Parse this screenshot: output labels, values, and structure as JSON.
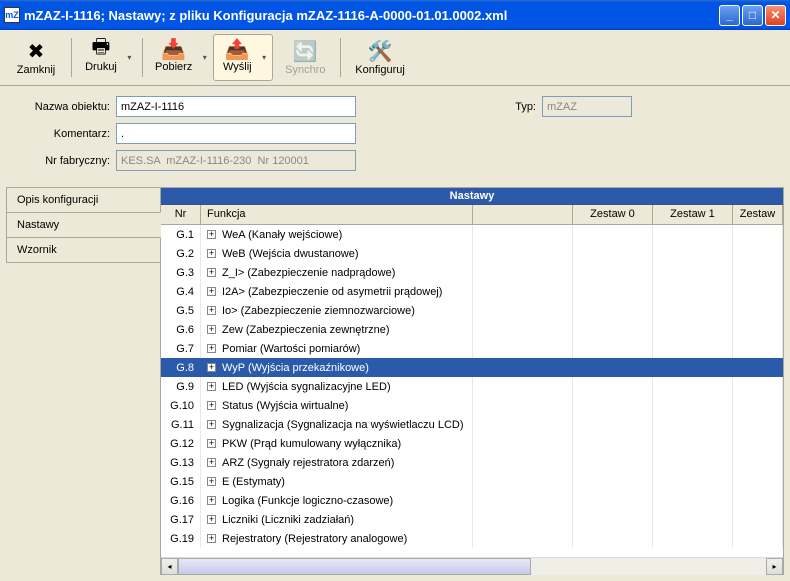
{
  "window": {
    "title": "mZAZ-I-1116; Nastawy; z pliku Konfiguracja mZAZ-1116-A-0000-01.01.0002.xml",
    "icon_label": "mZ"
  },
  "toolbar": {
    "zamknij": "Zamknij",
    "drukuj": "Drukuj",
    "pobierz": "Pobierz",
    "wyslij": "Wyślij",
    "synchro": "Synchro",
    "konfiguruj": "Konfiguruj"
  },
  "form": {
    "nazwa_label": "Nazwa obiektu:",
    "nazwa_value": "mZAZ-I-1116",
    "komentarz_label": "Komentarz:",
    "komentarz_value": ".",
    "typ_label": "Typ:",
    "typ_value": "mZAZ",
    "nrfab_label": "Nr fabryczny:",
    "nrfab_value": "KES.SA  mZAZ-I-1116-230  Nr 120001"
  },
  "tabs": {
    "opis": "Opis konfiguracji",
    "nastawy": "Nastawy",
    "wzornik": "Wzornik"
  },
  "pane": {
    "title": "Nastawy"
  },
  "columns": {
    "nr": "Nr",
    "funkcja": "Funkcja",
    "zestaw0": "Zestaw 0",
    "zestaw1": "Zestaw 1",
    "zestaw2": "Zestaw"
  },
  "rows": [
    {
      "nr": "G.1",
      "fn": "WeA (Kanały wejściowe)",
      "sel": false
    },
    {
      "nr": "G.2",
      "fn": "WeB (Wejścia dwustanowe)",
      "sel": false
    },
    {
      "nr": "G.3",
      "fn": "Z_I> (Zabezpieczenie nadprądowe)",
      "sel": false
    },
    {
      "nr": "G.4",
      "fn": "I2A> (Zabezpieczenie od asymetrii prądowej)",
      "sel": false
    },
    {
      "nr": "G.5",
      "fn": "Io> (Zabezpieczenie ziemnozwarciowe)",
      "sel": false
    },
    {
      "nr": "G.6",
      "fn": "Zew (Zabezpieczenia zewnętrzne)",
      "sel": false
    },
    {
      "nr": "G.7",
      "fn": "Pomiar (Wartości pomiarów)",
      "sel": false
    },
    {
      "nr": "G.8",
      "fn": "WyP (Wyjścia przekaźnikowe)",
      "sel": true
    },
    {
      "nr": "G.9",
      "fn": "LED (Wyjścia sygnalizacyjne LED)",
      "sel": false
    },
    {
      "nr": "G.10",
      "fn": "Status (Wyjścia wirtualne)",
      "sel": false
    },
    {
      "nr": "G.11",
      "fn": "Sygnalizacja (Sygnalizacja na wyświetlaczu LCD)",
      "sel": false
    },
    {
      "nr": "G.12",
      "fn": "PKW (Prąd kumulowany wyłącznika)",
      "sel": false
    },
    {
      "nr": "G.13",
      "fn": "ARZ (Sygnały rejestratora zdarzeń)",
      "sel": false
    },
    {
      "nr": "G.15",
      "fn": "E (Estymaty)",
      "sel": false
    },
    {
      "nr": "G.16",
      "fn": "Logika (Funkcje logiczno-czasowe)",
      "sel": false
    },
    {
      "nr": "G.17",
      "fn": "Liczniki (Liczniki zadziałań)",
      "sel": false
    },
    {
      "nr": "G.19",
      "fn": "Rejestratory (Rejestratory analogowe)",
      "sel": false
    }
  ]
}
